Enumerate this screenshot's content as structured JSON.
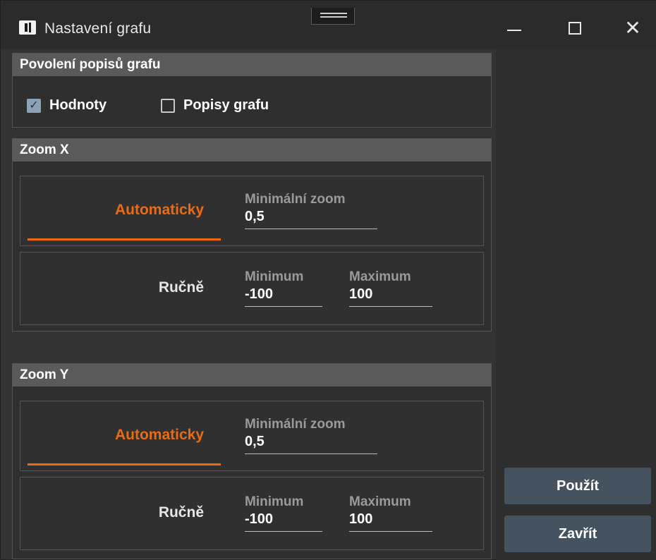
{
  "window": {
    "title": "Nastavení grafu"
  },
  "labels_group": {
    "header": "Povolení popisů grafu",
    "values_checkbox": {
      "label": "Hodnoty",
      "checked": true
    },
    "captions_checkbox": {
      "label": "Popisy grafu",
      "checked": false
    }
  },
  "zoom_x": {
    "header": "Zoom X",
    "auto": {
      "label": "Automaticky",
      "min_zoom_label": "Minimální zoom",
      "min_zoom_value": "0,5"
    },
    "manual": {
      "label": "Ručně",
      "minimum_label": "Minimum",
      "minimum_value": "-100",
      "maximum_label": "Maximum",
      "maximum_value": "100"
    }
  },
  "zoom_y": {
    "header": "Zoom Y",
    "auto": {
      "label": "Automaticky",
      "min_zoom_label": "Minimální zoom",
      "min_zoom_value": "0,5"
    },
    "manual": {
      "label": "Ručně",
      "minimum_label": "Minimum",
      "minimum_value": "-100",
      "maximum_label": "Maximum",
      "maximum_value": "100"
    }
  },
  "actions": {
    "apply_label": "Použít",
    "close_label": "Zavřít"
  },
  "colors": {
    "accent": "#ee6a10",
    "button_bg": "#44535f",
    "header_bg": "#5a5a5a"
  }
}
